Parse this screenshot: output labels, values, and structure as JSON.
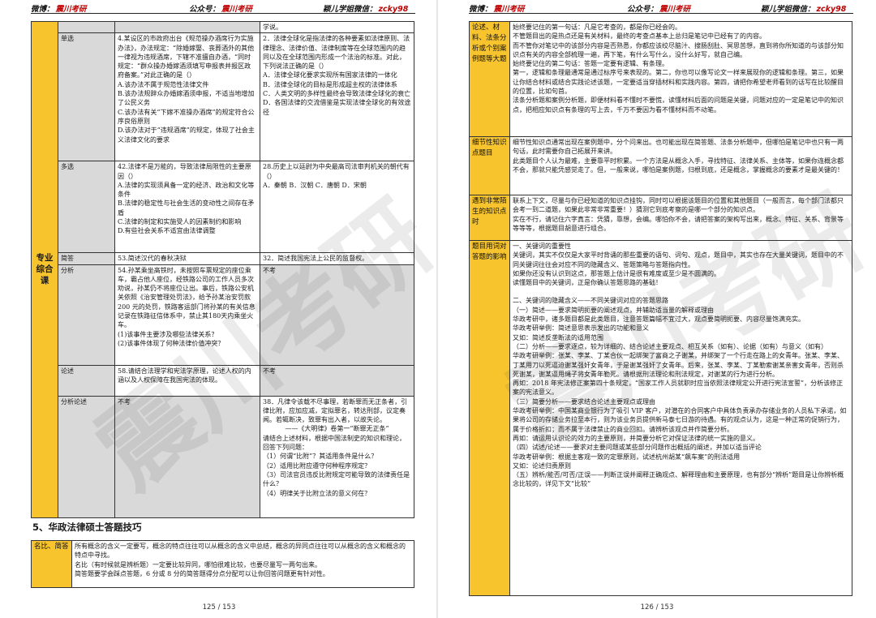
{
  "header": {
    "weibo_label": "微博：",
    "weibo_value": "震川考研",
    "gzh_label": "公众号：",
    "gzh_value": "震川考研",
    "wx_label": "颖儿学姐微信：",
    "wx_value": "zcky98"
  },
  "watermark": "震川考研",
  "left_page": {
    "page_number": "125 / 153",
    "side_label": "专业综合课",
    "top_cell": "学说。",
    "rows": [
      {
        "type": "单选",
        "col1": [
          "4.某设区的市政府出台《规范操办酒席行为实施办法》，办法规定：“除婚嫁娶、丧葬酒外的其他一律视为违规酒席，下辖不准擅自办酒，“同时规定：“群众操办婚嫁酒须填写申报表并报区政府备案。”对此正确的是（）",
          "A.该办法不属于规范性法律文件",
          "B.该办法规辞众办婚嫁酒须申报，不适当地增加了公民义务",
          "C.该办法有关“下嫁不准操办酒席”的规定符合公序良俗原则",
          "D.该办法对于“违规酒席”的规定，体现了社会主义法律文化的要求"
        ],
        "col2": [
          "2．法律全球化是指法律的各种要素如法律原则、法律理念、法律价值、法律制度等在全球范围内的趋同以及在全球范围内形成一个法治的标准。对此，下列说法正确的是（）",
          "A．法律全球化要求实现所有国家法律的一体化",
          "B．法律全球化的目标是形成超主权的法律体系",
          "C．人类文明的多样性最终会导致法律全球化的衰亡",
          "D．各国法律的交流借鉴是实现法律全球化的有效途径"
        ]
      },
      {
        "type": "多选",
        "col1": [
          "42.法律不是万能的，导致法律局限性的主要原因（）",
          "A.法律的实现须具备一定的经济、政治和文化等条件",
          "B.法律的稳定性与社会生活的变动性之间存在矛盾",
          "C.法律的制定和实施受人的因素制约和影响",
          "D.有些社会关系不适宜由法律调整"
        ],
        "col2": [
          "28.历史上以廷尉为中央最高司法审判机关的朝代有（）",
          "A．秦朝 B．汉朝 C．唐朝 D．宋朝"
        ]
      },
      {
        "type": "简答",
        "col1": [
          "53.简述汉代的春秋决狱"
        ],
        "col2": [
          "32．简述我国宪法上公民的监督权。"
        ]
      },
      {
        "type": "分析",
        "col1": [
          "54.孙某乘坐高铁时，未按照车票规定的座位乘车，霸占他人座位，经铁路公司的工作人员多次劝说，孙某仍不将座位让出。事后，铁路公安机关依照《治安管理处罚法》，给予孙某治安罚款 200 元的处罚，铁路客运部门将孙某的有关信息记录在铁路征信体系中，禁止其180天内乘坐火车。",
          "(1)该事件主要涉及哪些法律关系？",
          "(2)该事件体现了何种法律价值冲突？"
        ],
        "col2": [
          "不考"
        ]
      },
      {
        "type": "论述",
        "col1": [
          "58.请结合法理学和宪法学原理，论述人权的内涵以及人权保障在我国宪法的体现。"
        ],
        "col2": [
          "不考"
        ]
      },
      {
        "type": "分析论述",
        "col1": [
          "不考"
        ],
        "col2": [
          "38．凡律令该载不尽事理，若断罪而无正条者，引律比附，应加应减，定拟罪名，转达刑部，议定奏闻。若辄断决，致罪有出入者，以故失论。",
          "——《大明律》卷第一“断罪无正条”",
          "请结合上述材料，根据中国法制史的知识和理论，回答下列问题：",
          "（1）何谓“比附”？其适用条件是什么？",
          "（2）适用比附应遵守何种程序规定？",
          "（3）司法官员违反比附规定可能导致的法律责任是什么？",
          "（4）明律关于比附立法的意义何在？"
        ]
      }
    ],
    "section_title": "5、华政法律硕士答题技巧",
    "tips_label": "名比、简答",
    "tips_text": [
      "所有概念的含义一定要写，概念的特点往往可以从概念的含义中总结，概念的异同点往往可以从概念的含义和概念的特点中寻找。",
      "名比（有时候就是辨析题）一定要比较异同，哪怕很难比较，也要尽量写一两句出来。",
      "简答题要学会踩点答题，6 分或 8 分的简答题得分点分配可以让你回答问题更有针对性。"
    ]
  },
  "right_page": {
    "page_number": "126 / 153",
    "rows": [
      {
        "label": "论述、材料、法条分析或个别案例题等大题",
        "text": [
          "始终要记住的第一句话：凡是它考查的，都是你已经会的。",
          "不管题目出的是热点还是有关材料，最终的考查点基本上总归是笔记中已经有了的内容。",
          "而不管你对笔记中的该部分内容是否熟悉，你都应该绞尽脑汁、搜肠刮肚、冥思苦想，直到将你所知道的与该部分知识点有关的内容全部梳理一遍，再下笔，有什么写什么，没什么好写，就自己编。",
          "始终要记住的第二句话：答题一定要有逻辑、有条理。",
          "第一，逻辑和条理最通常是通过标序号来表现的。第二，你也可以像写论文一样来展现你的逻辑和条理。第三，如果让你结合材料或结合实践论述该题，一定要适当穿插材料和实践内容。第四，请把你希望老师看到的话写在比较醒目的位置，比如句首。",
          "法条分析题和案例分析题，即便材料看不懂时不要慌，读懂材料后面的问题是关键，问题对应的一定是笔记中的知识点，把相应知识点有条理的写上去，千万不要因为看不懂材料而不动笔。"
        ]
      },
      {
        "label": "细节性知识点题目",
        "text": [
          "细节性知识点通常出现在案例题中，分个问来出。也可能出现在简答题、法条分析题中，但哪怕是笔记中也只有一两句话，此时需要你自己拓展开来讲。",
          "此类题目个人认为最难，主要靠平时积累。一个方法是从概念入手，寻找特征、法律关系、主体等，如果你连概念都不会，那就只能凭感觉走了。但，一般来说，哪怕是案例题，归根到底，还是概念，掌握概念的要素才是最关键的！"
        ]
      },
      {
        "label": "遇到非常陌生的知识点时",
        "text": [
          "联系上下文，尽量与你已经知道的知识点挂钩，同时可以根据该题目的位置和其他题目（一般而言，每个部门法都只会考一到二道题，如果此非常非常重要！）猜测它到底考察的是哪一个部分的知识点。",
          "实在不行，请记住六字真言：凭猜，靠想，会编。哪怕你不会，请把答案的架构写出来，概念、特征、关系、背景等等等等，根据题目胡意进行组合。"
        ]
      },
      {
        "label": "题目用词对答题的影响",
        "text": [
          "一、关键词的重要性",
          "关键词，其实不仅仅是大家平时背诵的那些重要的语句、词句、观点，题目中，其实也存在大量关键词，题目中的不同关键词往往会对应不同的隐藏含义、答题策略与答题指向性。",
          "如果你还没有认识到这点，那答题上估计是很有难度或至少是不圆满的。",
          "读懂题目中的关键词，正是你确认答题思路的基础！",
          "",
          "二、关键词的隐藏含义——不同关键词对应的答题思路",
          "（一）简述——要求简明扼要的阐述观点，并辅助适当量的解释或理由",
          "华政考研中，诸多题目都是此类题目，注意答题篇幅不宜过大，观点要简明扼要、内容尽量饱满充实。",
          "华政考研举例：简述意思表示发出的功能和意义",
          "又如：简述反垄断法的适用范围",
          "（二）分析——要求逐点，较为详细的、结合论述主要观点、相互关系（如有）、论据（如有）与意义（如有）",
          "华政考研举例：张某、李某、丁某合伙一起绑架了富商之子谢某，并绑架了一个行走在路上的女青年。张某、李某、丁某用刀以死逼迫谢某强奸女青年，于是谢某强奸了女青年。后来，张某、李某、丁某勒索谢某亲害女青年，否则杀死谢某，谢某逼用绳子将女青年勒死。请根据刑法理论和刑法规定，对谢某的行为进行分析。",
          "再如：2018 年宪法修正案第四十条规定，“国家工作人员就职时应当依照法律规定公开进行宪法宣誓”，分析该修正案的宪法意义。",
          "（三）简要分析——要求结合论述主要观点或理由",
          "华政考研举例：中国某商业银行为了吸引 VIP 客户，对潜在的合同客户中具体负责承办存储业务的人员私下承诺，如果将公司的存储业务拉至本行，则为该业务员提供新马泰七日游的待遇。有的观点认为，这是一种正常的促销行为，属于价格折扣；而不属于法律禁止的商业回扣。请辨析该观点并作简要分析。",
          "再如：请运用认识论的效力的主要原则，并简要分析它对保证法律的统一实施的意义。",
          "（四）试述/论述——要求对主要问题或某些部分问题作出概括的阐述，并加以适当评论",
          "华政考研举例：根据主客观一致的定罪原则，试述杭州胡某“飙车案”的刑法适用",
          "又如：论述归责原则",
          "（五）辨析/能否/可否/正误——判断正误并阐释正确观点、解释理由和主要原理，也有部分“辨析”题目是让你辨析概念比较的，详见下文“比较”"
        ]
      }
    ]
  }
}
